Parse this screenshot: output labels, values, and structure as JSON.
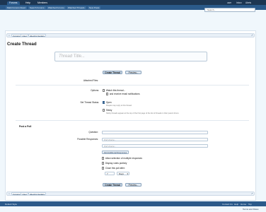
{
  "topnav": {
    "tabs": [
      "Forums",
      "Help",
      "Members"
    ],
    "right": [
      "user",
      "Inbox",
      "Alerts"
    ]
  },
  "subnav": {
    "items": [
      "Mark Forums Read",
      "Search Forums",
      "Watched Forums",
      "Watched Threads",
      "New Posts"
    ],
    "search_placeholder": "Search..."
  },
  "breadcrumb": [
    "Forums",
    "User",
    "Electric Guitars"
  ],
  "page": {
    "title": "Create Thread",
    "thread_title_placeholder": "Thread Title..."
  },
  "buttons": {
    "create": "Create Thread",
    "preview": "Preview..."
  },
  "attached_files_label": "Attached Files:",
  "options": {
    "label": "Options:",
    "watch": "Watch this thread...",
    "email": "and receive email notifications"
  },
  "status": {
    "label": "Set Thread Status:",
    "open": "Open",
    "open_hint": "People may reply to this thread.",
    "sticky": "Sticky",
    "sticky_hint": "Sticky threads appear at the top of the first page of the list of threads in their parent forum."
  },
  "poll": {
    "heading": "Post a Poll",
    "question_label": "Question:",
    "responses_label": "Possible Responses:",
    "response_placeholder": "Poll choice...",
    "add_response": "Add Additional Responses",
    "multiple": "Allow selection of multiple responses",
    "public": "Display votes publicly",
    "close": "Close this poll after:",
    "close_value": "7",
    "close_unit": "Days"
  },
  "footer": {
    "left": "Default Style",
    "links": [
      "Contact Us",
      "Help",
      "Home",
      "Top"
    ],
    "terms": "Terms and Rules"
  },
  "colors": {
    "nav_dark": "#1d3652",
    "nav_mid": "#2b5a8a",
    "page_bg": "#f0f7fc"
  },
  "icons": {
    "breadcrumb_home": "home-icon",
    "breadcrumb_end": "jump-icon"
  }
}
